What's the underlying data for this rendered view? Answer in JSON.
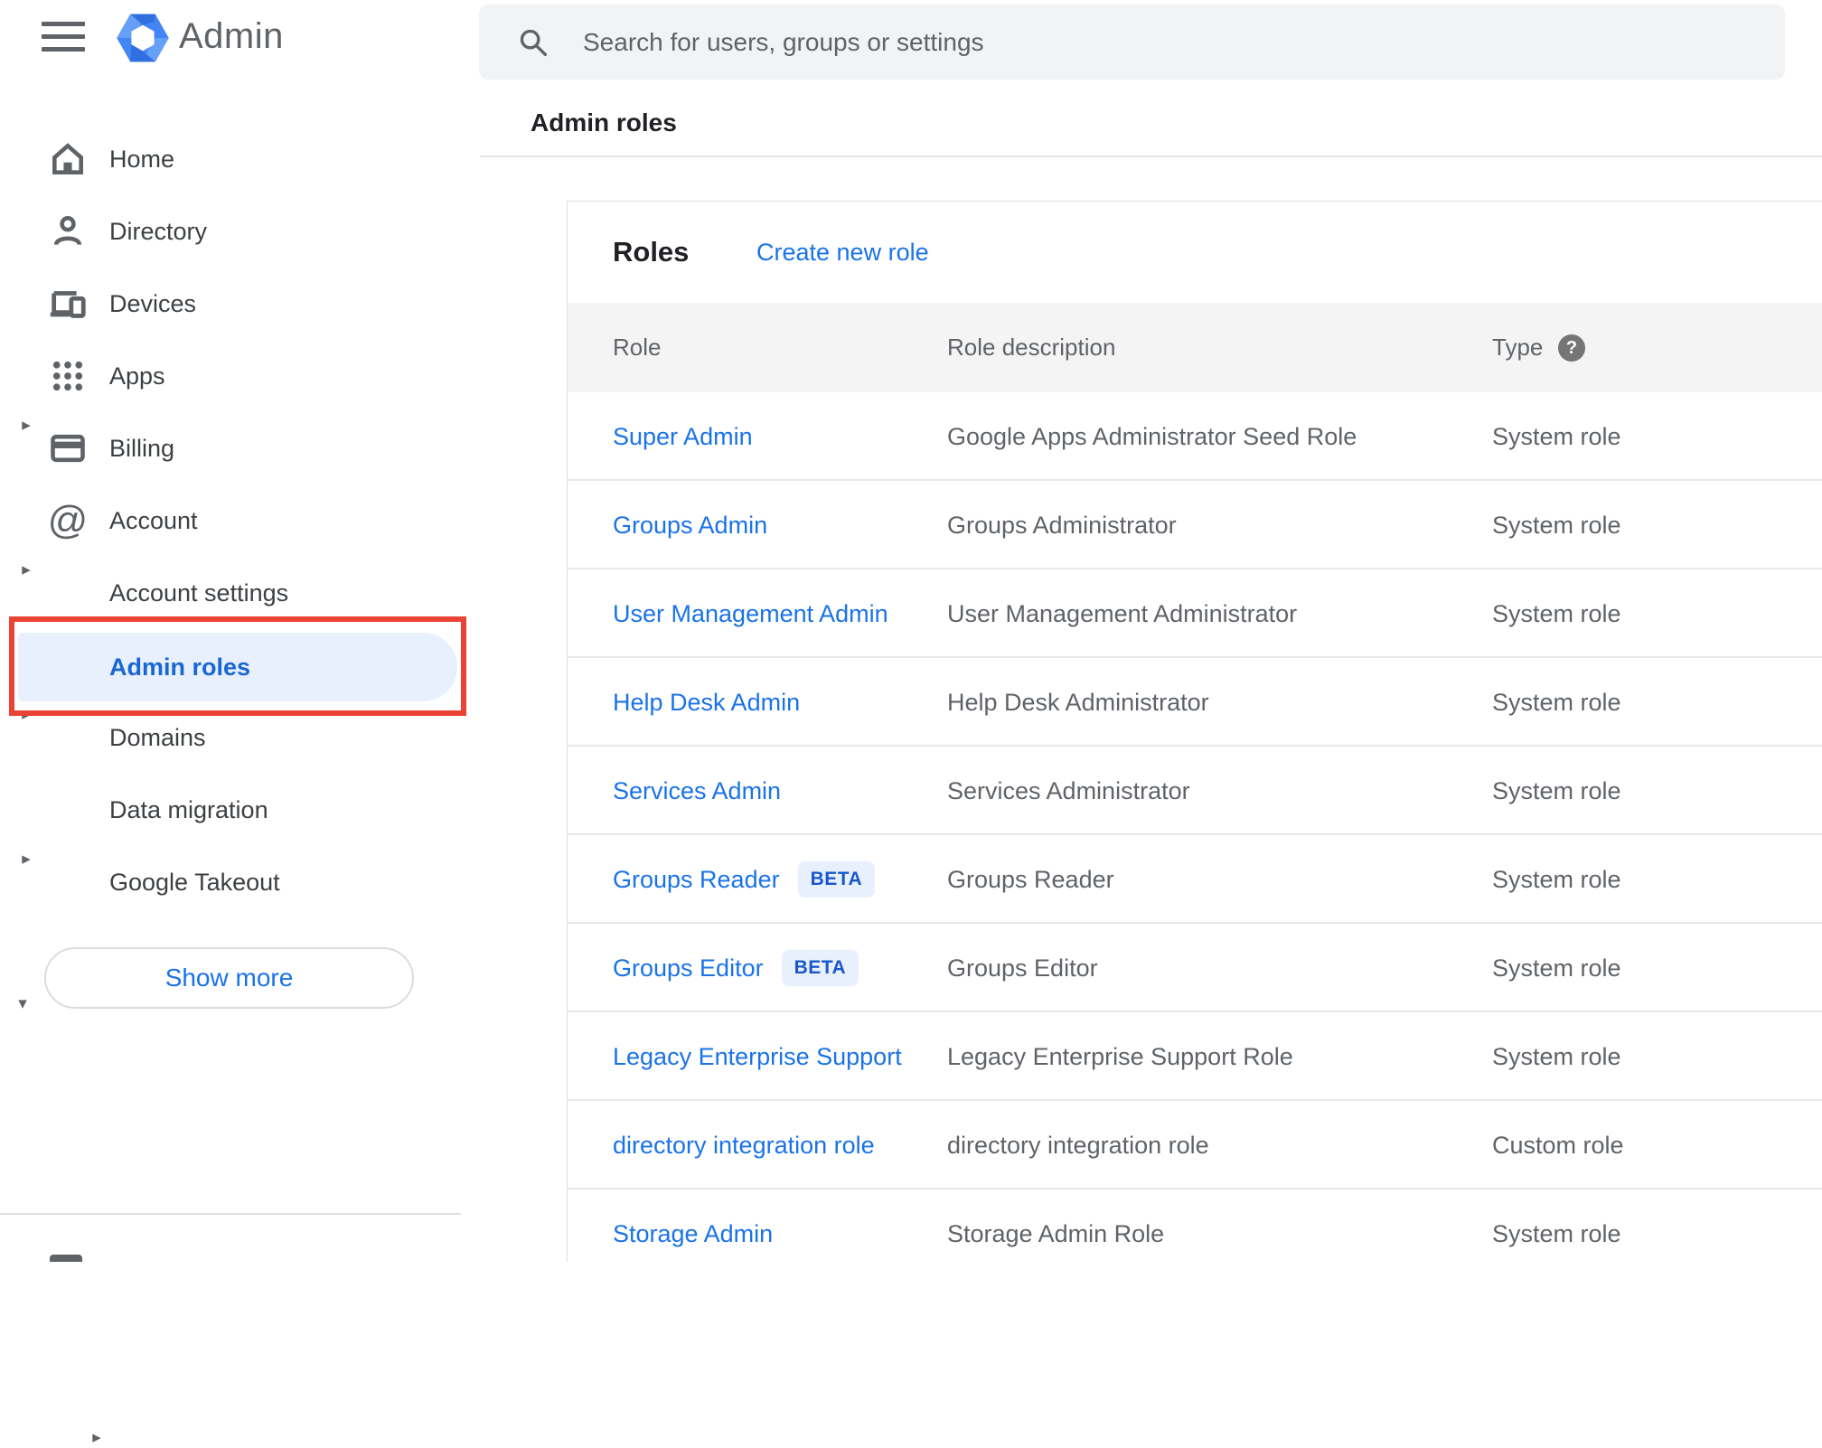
{
  "app": {
    "logo_text": "Admin"
  },
  "search": {
    "placeholder": "Search for users, groups or settings"
  },
  "breadcrumb": "Admin roles",
  "icons": {
    "expand_right": "▸",
    "expand_down": "▾",
    "account_at": "@",
    "help_glyph": "?"
  },
  "colors": {
    "annotation_red": "#ea4335",
    "selected_pill_bg": "#e8f0fe",
    "link_blue": "#1a73e8",
    "selected_blue": "#1967d2",
    "search_bg": "#f1f3f4",
    "table_header_bg": "#f4f4f4"
  },
  "sidebar": {
    "items": [
      {
        "label": "Home"
      },
      {
        "label": "Directory"
      },
      {
        "label": "Devices"
      },
      {
        "label": "Apps"
      },
      {
        "label": "Billing"
      },
      {
        "label": "Account"
      }
    ],
    "account_children": [
      {
        "label": "Account settings"
      },
      {
        "label": "Admin roles",
        "selected": true
      },
      {
        "label": "Domains"
      },
      {
        "label": "Data migration"
      },
      {
        "label": "Google Takeout"
      }
    ],
    "show_more_label": "Show more"
  },
  "main": {
    "roles_title": "Roles",
    "create_link": "Create new role",
    "table": {
      "headers": {
        "role": "Role",
        "description": "Role description",
        "type": "Type"
      },
      "rows": [
        {
          "role": "Super Admin",
          "description": "Google Apps Administrator Seed Role",
          "type": "System role"
        },
        {
          "role": "Groups Admin",
          "description": "Groups Administrator",
          "type": "System role"
        },
        {
          "role": "User Management Admin",
          "description": "User Management Administrator",
          "type": "System role"
        },
        {
          "role": "Help Desk Admin",
          "description": "Help Desk Administrator",
          "type": "System role"
        },
        {
          "role": "Services Admin",
          "description": "Services Administrator",
          "type": "System role"
        },
        {
          "role": "Groups Reader",
          "beta_label": "BETA",
          "description": "Groups Reader",
          "type": "System role"
        },
        {
          "role": "Groups Editor",
          "beta_label": "BETA",
          "description": "Groups Editor",
          "type": "System role"
        },
        {
          "role": "Legacy Enterprise Support",
          "description": "Legacy Enterprise Support Role",
          "type": "System role"
        },
        {
          "role": "directory integration role",
          "description": "directory integration role",
          "type": "Custom role"
        },
        {
          "role": "Storage Admin",
          "description": "Storage Admin Role",
          "type": "System role"
        }
      ]
    }
  }
}
